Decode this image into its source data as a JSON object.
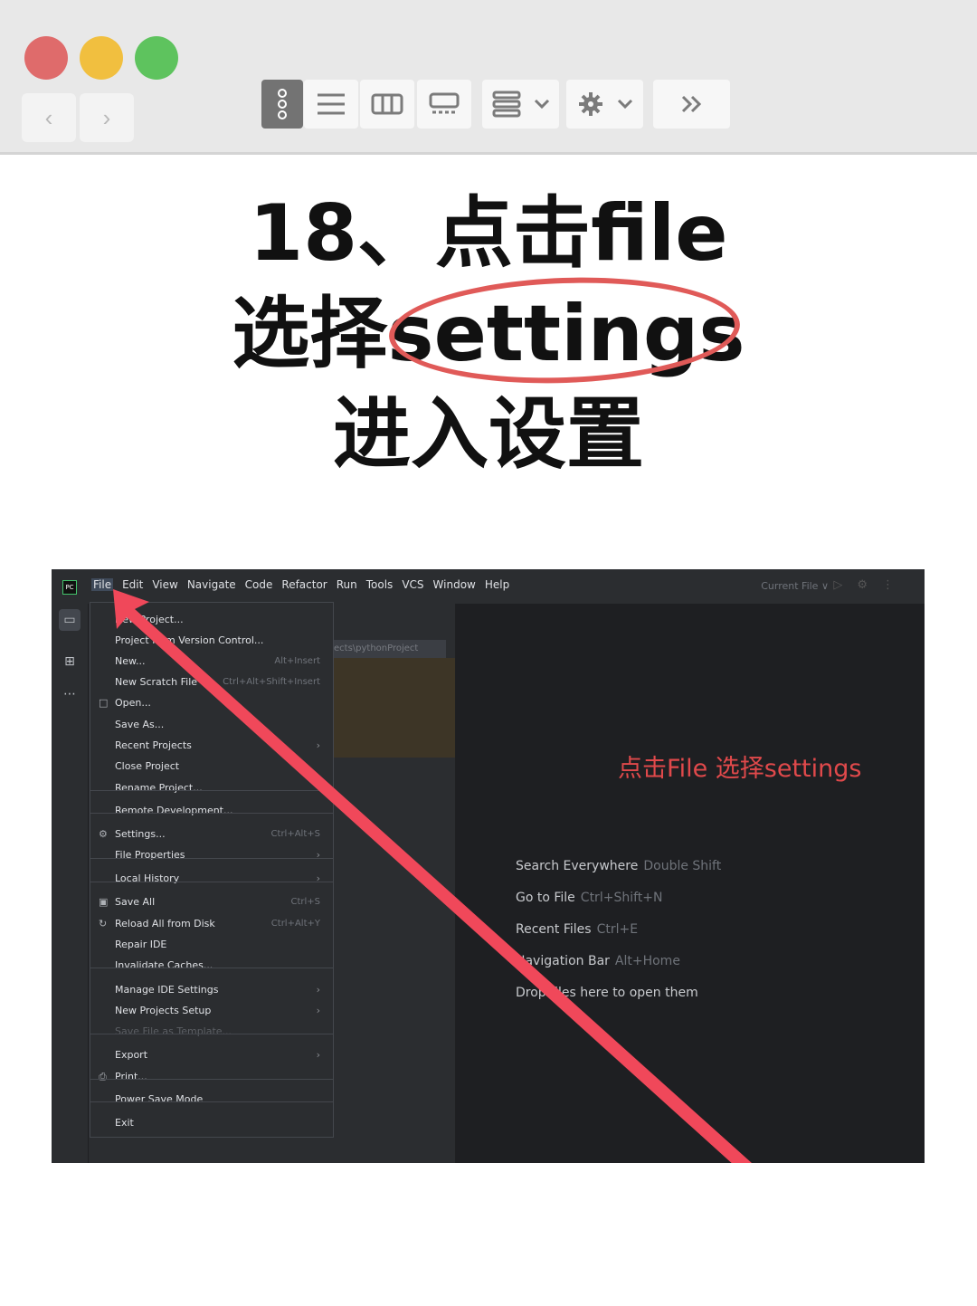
{
  "toolbar": {
    "back_icon": "‹",
    "forward_icon": "›",
    "buttons": [
      "menu-dots-icon",
      "list-icon",
      "columns-icon",
      "gallery-icon",
      "group-icon",
      "gear-icon",
      "chevron-double-right-icon"
    ]
  },
  "headline": {
    "line1": "18、点击file",
    "line2": "选择settings",
    "line3": "进入设置",
    "accent_color": "#e05a58"
  },
  "ide": {
    "menu": [
      "File",
      "Edit",
      "View",
      "Navigate",
      "Code",
      "Refactor",
      "Run",
      "Tools",
      "VCS",
      "Window",
      "Help"
    ],
    "current_file": "Current File ∨",
    "path_chip": "ects\\pythonProject",
    "file_menu": [
      {
        "label": "New Project...",
        "shortcut": ""
      },
      {
        "label": "Project from Version Control...",
        "shortcut": ""
      },
      {
        "label": "New...",
        "shortcut": "Alt+Insert"
      },
      {
        "label": "New Scratch File",
        "shortcut": "Ctrl+Alt+Shift+Insert"
      },
      {
        "label": "Open...",
        "shortcut": ""
      },
      {
        "label": "Save As...",
        "shortcut": ""
      },
      {
        "label": "Recent Projects",
        "shortcut": ""
      },
      {
        "label": "Close Project",
        "shortcut": ""
      },
      {
        "label": "Rename Project...",
        "shortcut": ""
      },
      {
        "label": "Remote Development...",
        "shortcut": ""
      },
      {
        "label": "Settings...",
        "shortcut": "Ctrl+Alt+S"
      },
      {
        "label": "File Properties",
        "shortcut": ""
      },
      {
        "label": "Local History",
        "shortcut": ""
      },
      {
        "label": "Save All",
        "shortcut": "Ctrl+S"
      },
      {
        "label": "Reload All from Disk",
        "shortcut": "Ctrl+Alt+Y"
      },
      {
        "label": "Repair IDE",
        "shortcut": ""
      },
      {
        "label": "Invalidate Caches...",
        "shortcut": ""
      },
      {
        "label": "Manage IDE Settings",
        "shortcut": ""
      },
      {
        "label": "New Projects Setup",
        "shortcut": ""
      },
      {
        "label": "Save File as Template...",
        "shortcut": ""
      },
      {
        "label": "Export",
        "shortcut": ""
      },
      {
        "label": "Print...",
        "shortcut": ""
      },
      {
        "label": "Power Save Mode",
        "shortcut": ""
      },
      {
        "label": "Exit",
        "shortcut": ""
      }
    ],
    "red_note": "点击File 选择settings",
    "hints": [
      {
        "label": "Search Everywhere",
        "key": "Double Shift"
      },
      {
        "label": "Go to File",
        "key": "Ctrl+Shift+N"
      },
      {
        "label": "Recent Files",
        "key": "Ctrl+E"
      },
      {
        "label": "Navigation Bar",
        "key": "Alt+Home"
      },
      {
        "label": "Drop files here to open them",
        "key": ""
      }
    ]
  }
}
